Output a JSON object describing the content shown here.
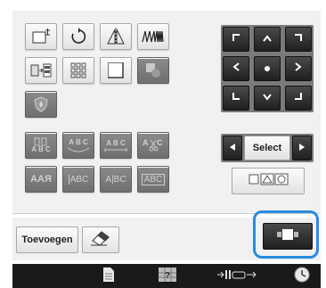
{
  "select": {
    "label": "Select"
  },
  "footer": {
    "add_label": "Toevoegen"
  },
  "text_buttons": {
    "abc_arc_top": "A B C",
    "abc_arc_bottom": "A B C",
    "abc_straight": "A B C",
    "abc_spaced": "A|BC",
    "abc_framed": "ABC",
    "abc_boxed": "ABC",
    "aa_size": "AAЯ"
  },
  "colors": {
    "highlight": "#2a8be0",
    "panel": "#f1f1f1",
    "dark_key": "#1f1f1f",
    "status_bar": "#1a1a1a"
  },
  "icons": [
    "resize-icon",
    "rotate-icon",
    "mirror-icon",
    "density-icon",
    "group-color-icon",
    "array-icon",
    "border-icon",
    "applique-icon",
    "shield-icon",
    "vertical-text-icon",
    "arc-text-icon",
    "straight-text-icon",
    "cut-text-icon",
    "size-text-icon",
    "framed-text-icon",
    "spacing-text-icon",
    "boxed-text-icon",
    "eraser-icon",
    "move-frame-icon",
    "page-icon",
    "grid-icon",
    "presser-foot-icon",
    "clock-icon"
  ]
}
